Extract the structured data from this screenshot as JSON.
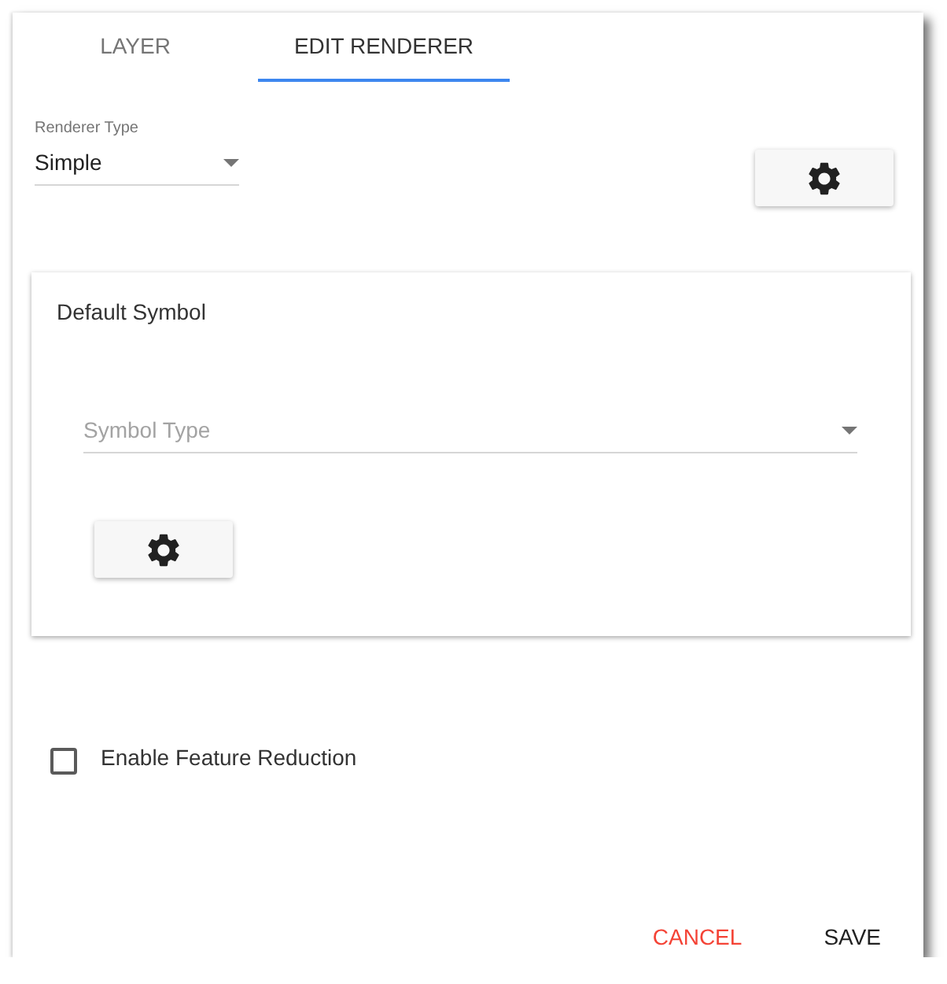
{
  "tabs": [
    {
      "label": "LAYER",
      "selected": false
    },
    {
      "label": "EDIT RENDERER",
      "selected": true
    }
  ],
  "renderer_type": {
    "label": "Renderer Type",
    "value": "Simple"
  },
  "default_symbol": {
    "title": "Default Symbol",
    "symbol_type": {
      "placeholder": "Symbol Type"
    }
  },
  "feature_reduction": {
    "label": "Enable Feature Reduction",
    "checked": false
  },
  "buttons": [
    {
      "label": "CANCEL",
      "kind": "cancel"
    },
    {
      "label": "SAVE",
      "kind": "save"
    }
  ]
}
